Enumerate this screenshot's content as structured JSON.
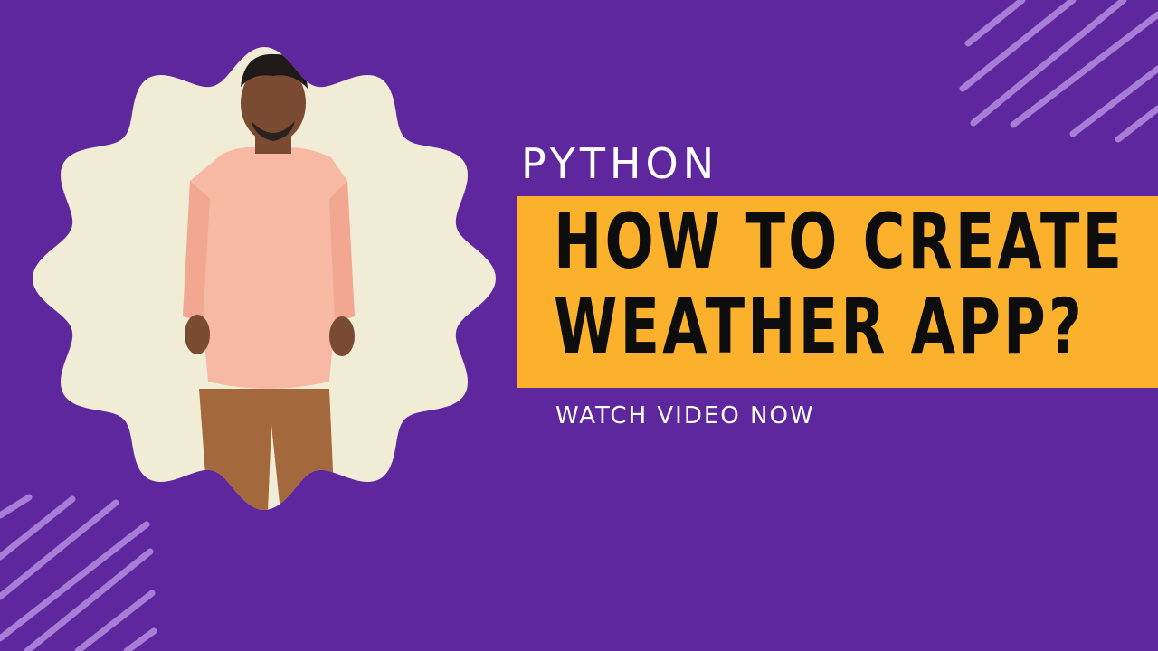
{
  "thumbnail": {
    "kicker": "PYTHON",
    "headline_lines": [
      "HOW TO CREATE",
      "WEATHER APP?"
    ],
    "cta": "WATCH VIDEO NOW"
  },
  "colors": {
    "background": "#5f279e",
    "banner": "#fbb12b",
    "photo_backdrop": "#f1ecd6",
    "stripes": "#b38ee0"
  },
  "icons": [
    "person-photo",
    "decorative-stripes"
  ]
}
